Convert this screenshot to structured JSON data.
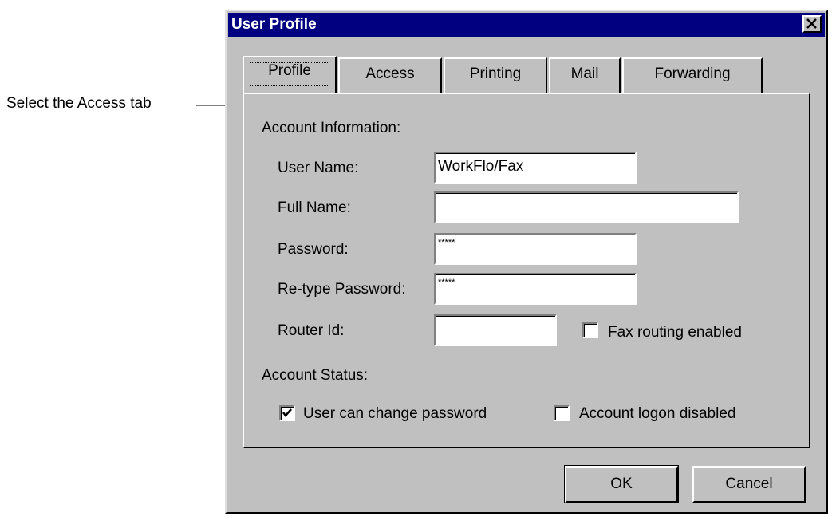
{
  "callout": {
    "text": "Select the Access tab"
  },
  "dialog": {
    "title": "User Profile",
    "close_icon": "close-icon"
  },
  "tabs": [
    {
      "label": "Profile",
      "selected": true
    },
    {
      "label": "Access"
    },
    {
      "label": "Printing"
    },
    {
      "label": "Mail"
    },
    {
      "label": "Forwarding"
    }
  ],
  "account_info": {
    "heading": "Account Information:",
    "user_name_label": "User Name:",
    "user_name_value": "WorkFlo/Fax",
    "full_name_label": "Full Name:",
    "full_name_value": "",
    "password_label": "Password:",
    "password_value": "*****",
    "retype_label": "Re-type Password:",
    "retype_value": "*****",
    "router_label": "Router Id:",
    "router_value": "",
    "fax_routing_label": "Fax routing enabled",
    "fax_routing_checked": false
  },
  "account_status": {
    "heading": "Account Status:",
    "change_pw_label": "User can change password",
    "change_pw_checked": true,
    "logon_disabled_label": "Account logon disabled",
    "logon_disabled_checked": false
  },
  "buttons": {
    "ok": "OK",
    "cancel": "Cancel"
  }
}
